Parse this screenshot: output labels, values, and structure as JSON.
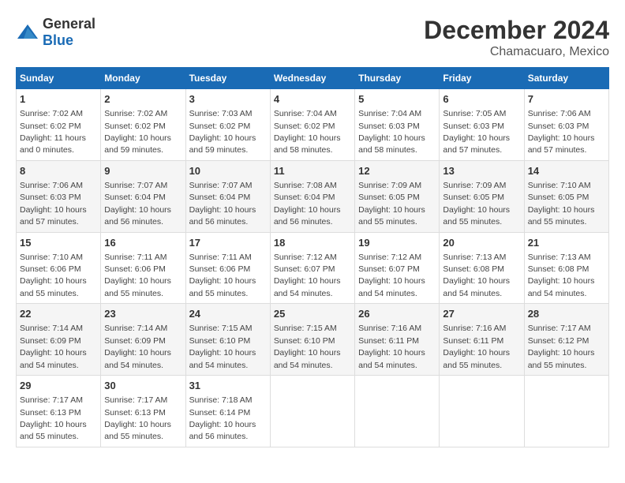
{
  "header": {
    "logo": {
      "general": "General",
      "blue": "Blue"
    },
    "title": "December 2024",
    "subtitle": "Chamacuaro, Mexico"
  },
  "calendar": {
    "days_of_week": [
      "Sunday",
      "Monday",
      "Tuesday",
      "Wednesday",
      "Thursday",
      "Friday",
      "Saturday"
    ],
    "weeks": [
      [
        {
          "day": "1",
          "info": "Sunrise: 7:02 AM\nSunset: 6:02 PM\nDaylight: 11 hours\nand 0 minutes."
        },
        {
          "day": "2",
          "info": "Sunrise: 7:02 AM\nSunset: 6:02 PM\nDaylight: 10 hours\nand 59 minutes."
        },
        {
          "day": "3",
          "info": "Sunrise: 7:03 AM\nSunset: 6:02 PM\nDaylight: 10 hours\nand 59 minutes."
        },
        {
          "day": "4",
          "info": "Sunrise: 7:04 AM\nSunset: 6:02 PM\nDaylight: 10 hours\nand 58 minutes."
        },
        {
          "day": "5",
          "info": "Sunrise: 7:04 AM\nSunset: 6:03 PM\nDaylight: 10 hours\nand 58 minutes."
        },
        {
          "day": "6",
          "info": "Sunrise: 7:05 AM\nSunset: 6:03 PM\nDaylight: 10 hours\nand 57 minutes."
        },
        {
          "day": "7",
          "info": "Sunrise: 7:06 AM\nSunset: 6:03 PM\nDaylight: 10 hours\nand 57 minutes."
        }
      ],
      [
        {
          "day": "8",
          "info": "Sunrise: 7:06 AM\nSunset: 6:03 PM\nDaylight: 10 hours\nand 57 minutes."
        },
        {
          "day": "9",
          "info": "Sunrise: 7:07 AM\nSunset: 6:04 PM\nDaylight: 10 hours\nand 56 minutes."
        },
        {
          "day": "10",
          "info": "Sunrise: 7:07 AM\nSunset: 6:04 PM\nDaylight: 10 hours\nand 56 minutes."
        },
        {
          "day": "11",
          "info": "Sunrise: 7:08 AM\nSunset: 6:04 PM\nDaylight: 10 hours\nand 56 minutes."
        },
        {
          "day": "12",
          "info": "Sunrise: 7:09 AM\nSunset: 6:05 PM\nDaylight: 10 hours\nand 55 minutes."
        },
        {
          "day": "13",
          "info": "Sunrise: 7:09 AM\nSunset: 6:05 PM\nDaylight: 10 hours\nand 55 minutes."
        },
        {
          "day": "14",
          "info": "Sunrise: 7:10 AM\nSunset: 6:05 PM\nDaylight: 10 hours\nand 55 minutes."
        }
      ],
      [
        {
          "day": "15",
          "info": "Sunrise: 7:10 AM\nSunset: 6:06 PM\nDaylight: 10 hours\nand 55 minutes."
        },
        {
          "day": "16",
          "info": "Sunrise: 7:11 AM\nSunset: 6:06 PM\nDaylight: 10 hours\nand 55 minutes."
        },
        {
          "day": "17",
          "info": "Sunrise: 7:11 AM\nSunset: 6:06 PM\nDaylight: 10 hours\nand 55 minutes."
        },
        {
          "day": "18",
          "info": "Sunrise: 7:12 AM\nSunset: 6:07 PM\nDaylight: 10 hours\nand 54 minutes."
        },
        {
          "day": "19",
          "info": "Sunrise: 7:12 AM\nSunset: 6:07 PM\nDaylight: 10 hours\nand 54 minutes."
        },
        {
          "day": "20",
          "info": "Sunrise: 7:13 AM\nSunset: 6:08 PM\nDaylight: 10 hours\nand 54 minutes."
        },
        {
          "day": "21",
          "info": "Sunrise: 7:13 AM\nSunset: 6:08 PM\nDaylight: 10 hours\nand 54 minutes."
        }
      ],
      [
        {
          "day": "22",
          "info": "Sunrise: 7:14 AM\nSunset: 6:09 PM\nDaylight: 10 hours\nand 54 minutes."
        },
        {
          "day": "23",
          "info": "Sunrise: 7:14 AM\nSunset: 6:09 PM\nDaylight: 10 hours\nand 54 minutes."
        },
        {
          "day": "24",
          "info": "Sunrise: 7:15 AM\nSunset: 6:10 PM\nDaylight: 10 hours\nand 54 minutes."
        },
        {
          "day": "25",
          "info": "Sunrise: 7:15 AM\nSunset: 6:10 PM\nDaylight: 10 hours\nand 54 minutes."
        },
        {
          "day": "26",
          "info": "Sunrise: 7:16 AM\nSunset: 6:11 PM\nDaylight: 10 hours\nand 54 minutes."
        },
        {
          "day": "27",
          "info": "Sunrise: 7:16 AM\nSunset: 6:11 PM\nDaylight: 10 hours\nand 55 minutes."
        },
        {
          "day": "28",
          "info": "Sunrise: 7:17 AM\nSunset: 6:12 PM\nDaylight: 10 hours\nand 55 minutes."
        }
      ],
      [
        {
          "day": "29",
          "info": "Sunrise: 7:17 AM\nSunset: 6:13 PM\nDaylight: 10 hours\nand 55 minutes."
        },
        {
          "day": "30",
          "info": "Sunrise: 7:17 AM\nSunset: 6:13 PM\nDaylight: 10 hours\nand 55 minutes."
        },
        {
          "day": "31",
          "info": "Sunrise: 7:18 AM\nSunset: 6:14 PM\nDaylight: 10 hours\nand 56 minutes."
        },
        {
          "day": "",
          "info": ""
        },
        {
          "day": "",
          "info": ""
        },
        {
          "day": "",
          "info": ""
        },
        {
          "day": "",
          "info": ""
        }
      ]
    ]
  }
}
